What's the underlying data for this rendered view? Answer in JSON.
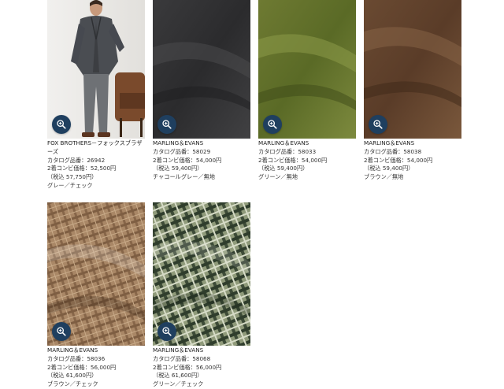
{
  "products": [
    {
      "brand": "FOX BROTHERS－フォックスブラザーズ",
      "catalog": "カタログ品番：26942",
      "price": "2着コンビ価格：52,500円",
      "tax": "（税込 57,750円）",
      "color": "グレー／チェック",
      "icon": "zoom-in-icon"
    },
    {
      "brand": "MARLING＆EVANS",
      "catalog": "カタログ品番：58029",
      "price": "2着コンビ価格：54,000円",
      "tax": "（税込 59,400円）",
      "color": "チャコールグレー／無地",
      "icon": "zoom-in-icon"
    },
    {
      "brand": "MARLING＆EVANS",
      "catalog": "カタログ品番：58033",
      "price": "2着コンビ価格：54,000円",
      "tax": "（税込 59,400円）",
      "color": "グリーン／無地",
      "icon": "zoom-in-icon"
    },
    {
      "brand": "MARLING＆EVANS",
      "catalog": "カタログ品番：58038",
      "price": "2着コンビ価格：54,000円",
      "tax": "（税込 59,400円）",
      "color": "ブラウン／無地",
      "icon": "zoom-in-icon"
    },
    {
      "brand": "MARLING＆EVANS",
      "catalog": "カタログ品番：58036",
      "price": "2着コンビ価格：56,000円",
      "tax": "（税込 61,600円）",
      "color": "ブラウン／チェック",
      "icon": "zoom-in-icon"
    },
    {
      "brand": "MARLING＆EVANS",
      "catalog": "カタログ品番：58068",
      "price": "2着コンビ価格：56,000円",
      "tax": "（税込 61,600円）",
      "color": "グリーン／チェック",
      "icon": "zoom-in-icon"
    }
  ],
  "colors": {
    "zoom_button": "#1f3f5f",
    "text": "#333333"
  }
}
